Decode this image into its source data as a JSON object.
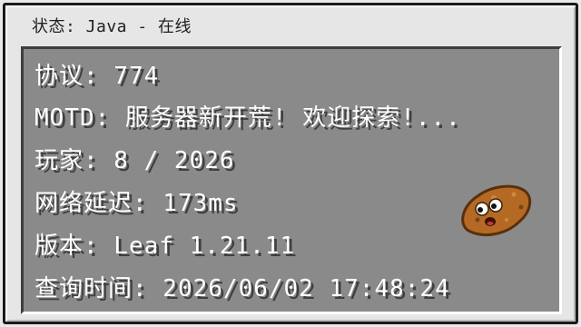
{
  "title": "状态: Java - 在线",
  "info": {
    "protocol": "协议: 774",
    "motd": "MOTD: 服务器新开荒! 欢迎探索!...",
    "players": "玩家: 8 / 2026",
    "latency": "网络延迟: 173ms",
    "version": "版本: Leaf 1.21.11",
    "query_time": "查询时间: 2026/06/02 17:48:24"
  },
  "icon": "potato-icon",
  "colors": {
    "window_bg": "#e6e6e6",
    "panel_bg": "#8a8a8a",
    "text": "#ffffff",
    "text_shadow": "#3f3f3f",
    "potato": "#b46a25"
  }
}
